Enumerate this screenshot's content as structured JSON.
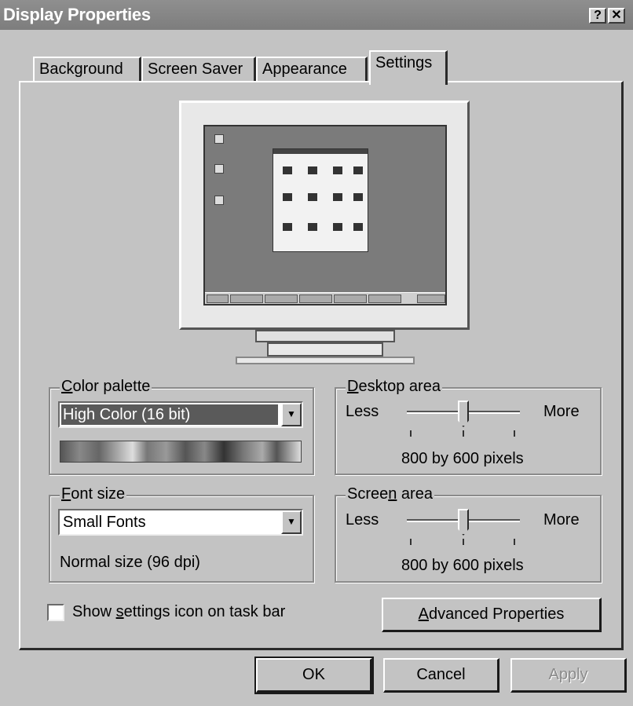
{
  "window": {
    "title": "Display Properties",
    "help_btn": "?",
    "close_btn": "✕"
  },
  "tabs": [
    {
      "label": "Background"
    },
    {
      "label": "Screen Saver"
    },
    {
      "label": "Appearance"
    },
    {
      "label": "Settings"
    }
  ],
  "color_palette": {
    "legend_first": "C",
    "legend_rest": "olor palette",
    "selected": "High Color (16 bit)"
  },
  "font_size": {
    "legend_first": "F",
    "legend_rest": "ont size",
    "selected": "Small Fonts",
    "note": "Normal size (96 dpi)"
  },
  "desktop_area": {
    "legend_first": "D",
    "legend_rest": "esktop area",
    "less": "Less",
    "more": "More",
    "value_text": "800 by 600 pixels",
    "slider_level": 0.5
  },
  "screen_area": {
    "legend_pre": "Scree",
    "legend_u": "n",
    "legend_post": " area",
    "less": "Less",
    "more": "More",
    "value_text": "800 by 600 pixels",
    "slider_level": 0.5
  },
  "show_icon": {
    "label_pre": "Show ",
    "label_u": "s",
    "label_post": "ettings icon on task bar",
    "checked": false
  },
  "advanced_button": {
    "label_u": "A",
    "label_rest": "dvanced Properties"
  },
  "buttons": {
    "ok": "OK",
    "cancel": "Cancel",
    "apply": "Apply"
  }
}
